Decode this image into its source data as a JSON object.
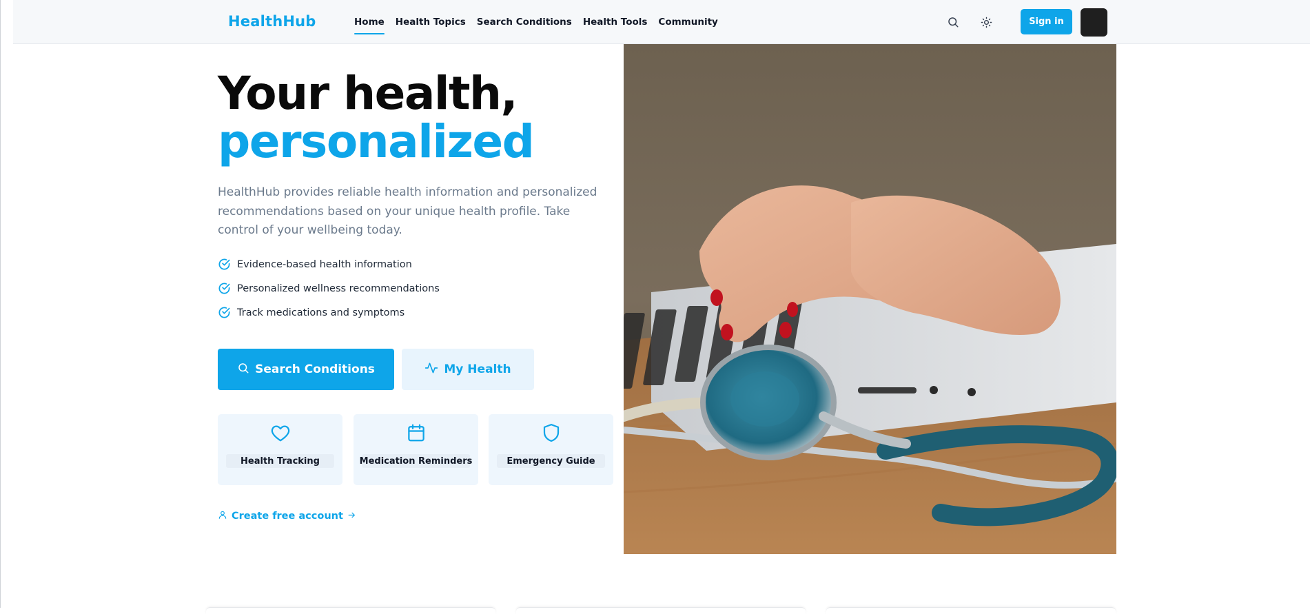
{
  "header": {
    "logo": "HealthHub",
    "nav": [
      "Home",
      "Health Topics",
      "Search Conditions",
      "Health Tools",
      "Community"
    ],
    "active_nav": "Home",
    "signin_label": "Sign in"
  },
  "hero": {
    "title_line1": "Your health,",
    "title_line2": "personalized",
    "lead": "HealthHub provides reliable health information and personalized recommendations based on your unique health profile. Take control of your wellbeing today.",
    "features": [
      "Evidence-based health information",
      "Personalized wellness recommendations",
      "Track medications and symptoms"
    ],
    "primary_button": "Search Conditions",
    "secondary_button": "My Health",
    "tiles": [
      {
        "label": "Health Tracking",
        "icon": "heart-icon"
      },
      {
        "label": "Medication Reminders",
        "icon": "calendar-icon"
      },
      {
        "label": "Emergency Guide",
        "icon": "shield-icon"
      }
    ],
    "create_account": "Create free account"
  },
  "colors": {
    "accent": "#0ea5e9",
    "accent_light": "#e8f4fd",
    "text_dark": "#0a0a0a",
    "text_muted": "#6b7a8c"
  }
}
